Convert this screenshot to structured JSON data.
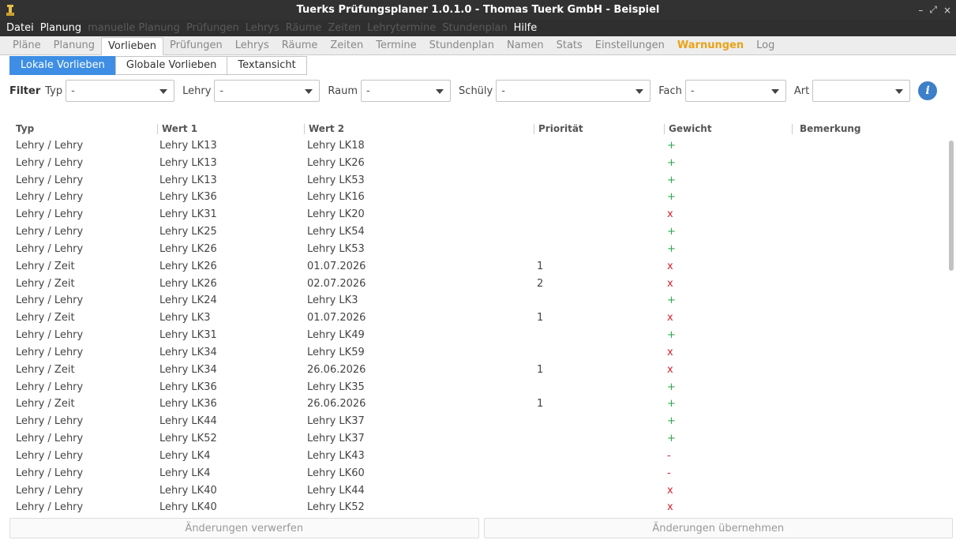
{
  "window": {
    "title": "Tuerks Prüfungsplaner 1.0.1.0 - Thomas Tuerk GmbH - Beispiel",
    "controls": [
      "–",
      "⤢",
      "×"
    ]
  },
  "menu": [
    {
      "label": "Datei",
      "disabled": false
    },
    {
      "label": "Planung",
      "disabled": false
    },
    {
      "label": "manuelle Planung",
      "disabled": true
    },
    {
      "label": "Prüfungen",
      "disabled": true
    },
    {
      "label": "Lehrys",
      "disabled": true
    },
    {
      "label": "Räume",
      "disabled": true
    },
    {
      "label": "Zeiten",
      "disabled": true
    },
    {
      "label": "Lehrytermine",
      "disabled": true
    },
    {
      "label": "Stundenplan",
      "disabled": true
    },
    {
      "label": "Hilfe",
      "disabled": false
    }
  ],
  "tabs": [
    {
      "label": "Pläne"
    },
    {
      "label": "Planung"
    },
    {
      "label": "Vorlieben",
      "active": true
    },
    {
      "label": "Prüfungen"
    },
    {
      "label": "Lehrys"
    },
    {
      "label": "Räume"
    },
    {
      "label": "Zeiten"
    },
    {
      "label": "Termine"
    },
    {
      "label": "Stundenplan"
    },
    {
      "label": "Namen"
    },
    {
      "label": "Stats"
    },
    {
      "label": "Einstellungen"
    },
    {
      "label": "Warnungen",
      "warn": true
    },
    {
      "label": "Log"
    }
  ],
  "subtabs": [
    {
      "label": "Lokale Vorlieben",
      "active": true
    },
    {
      "label": "Globale Vorlieben"
    },
    {
      "label": "Textansicht"
    }
  ],
  "filter": {
    "label": "Filter",
    "fields": [
      {
        "label": "Typ",
        "value": "-"
      },
      {
        "label": "Lehry",
        "value": "-"
      },
      {
        "label": "Raum",
        "value": "-"
      },
      {
        "label": "Schüly",
        "value": "-"
      },
      {
        "label": "Fach",
        "value": "-"
      },
      {
        "label": "Art",
        "value": ""
      }
    ],
    "info_glyph": "i"
  },
  "table": {
    "columns": [
      "Typ",
      "Wert 1",
      "Wert 2",
      "Priorität",
      "Gewicht",
      "Bemerkung"
    ],
    "rows": [
      {
        "typ": "Lehry / Lehry",
        "w1": "Lehry LK13",
        "w2": "Lehry LK18",
        "prio": "",
        "gewicht": "+",
        "bem": ""
      },
      {
        "typ": "Lehry / Lehry",
        "w1": "Lehry LK13",
        "w2": "Lehry LK26",
        "prio": "",
        "gewicht": "+",
        "bem": ""
      },
      {
        "typ": "Lehry / Lehry",
        "w1": "Lehry LK13",
        "w2": "Lehry LK53",
        "prio": "",
        "gewicht": "+",
        "bem": ""
      },
      {
        "typ": "Lehry / Lehry",
        "w1": "Lehry LK36",
        "w2": "Lehry LK16",
        "prio": "",
        "gewicht": "+",
        "bem": ""
      },
      {
        "typ": "Lehry / Lehry",
        "w1": "Lehry LK31",
        "w2": "Lehry LK20",
        "prio": "",
        "gewicht": "x",
        "bem": ""
      },
      {
        "typ": "Lehry / Lehry",
        "w1": "Lehry LK25",
        "w2": "Lehry LK54",
        "prio": "",
        "gewicht": "+",
        "bem": ""
      },
      {
        "typ": "Lehry / Lehry",
        "w1": "Lehry LK26",
        "w2": "Lehry LK53",
        "prio": "",
        "gewicht": "+",
        "bem": ""
      },
      {
        "typ": "Lehry / Zeit",
        "w1": "Lehry LK26",
        "w2": "01.07.2026",
        "prio": "1",
        "gewicht": "x",
        "bem": ""
      },
      {
        "typ": "Lehry / Zeit",
        "w1": "Lehry LK26",
        "w2": "02.07.2026",
        "prio": "2",
        "gewicht": "x",
        "bem": ""
      },
      {
        "typ": "Lehry / Lehry",
        "w1": "Lehry LK24",
        "w2": "Lehry LK3",
        "prio": "",
        "gewicht": "+",
        "bem": ""
      },
      {
        "typ": "Lehry / Zeit",
        "w1": "Lehry LK3",
        "w2": "01.07.2026",
        "prio": "1",
        "gewicht": "x",
        "bem": ""
      },
      {
        "typ": "Lehry / Lehry",
        "w1": "Lehry LK31",
        "w2": "Lehry LK49",
        "prio": "",
        "gewicht": "+",
        "bem": ""
      },
      {
        "typ": "Lehry / Lehry",
        "w1": "Lehry LK34",
        "w2": "Lehry LK59",
        "prio": "",
        "gewicht": "x",
        "bem": ""
      },
      {
        "typ": "Lehry / Zeit",
        "w1": "Lehry LK34",
        "w2": "26.06.2026",
        "prio": "1",
        "gewicht": "x",
        "bem": ""
      },
      {
        "typ": "Lehry / Lehry",
        "w1": "Lehry LK36",
        "w2": "Lehry LK35",
        "prio": "",
        "gewicht": "+",
        "bem": ""
      },
      {
        "typ": "Lehry / Zeit",
        "w1": "Lehry LK36",
        "w2": "26.06.2026",
        "prio": "1",
        "gewicht": "+",
        "bem": ""
      },
      {
        "typ": "Lehry / Lehry",
        "w1": "Lehry LK44",
        "w2": "Lehry LK37",
        "prio": "",
        "gewicht": "+",
        "bem": ""
      },
      {
        "typ": "Lehry / Lehry",
        "w1": "Lehry LK52",
        "w2": "Lehry LK37",
        "prio": "",
        "gewicht": "+",
        "bem": ""
      },
      {
        "typ": "Lehry / Lehry",
        "w1": "Lehry LK4",
        "w2": "Lehry LK43",
        "prio": "",
        "gewicht": "-",
        "bem": ""
      },
      {
        "typ": "Lehry / Lehry",
        "w1": "Lehry LK4",
        "w2": "Lehry LK60",
        "prio": "",
        "gewicht": "-",
        "bem": ""
      },
      {
        "typ": "Lehry / Lehry",
        "w1": "Lehry LK40",
        "w2": "Lehry LK44",
        "prio": "",
        "gewicht": "x",
        "bem": ""
      },
      {
        "typ": "Lehry / Lehry",
        "w1": "Lehry LK40",
        "w2": "Lehry LK52",
        "prio": "",
        "gewicht": "x",
        "bem": ""
      }
    ]
  },
  "footer": {
    "discard_label": "Änderungen verwerfen",
    "apply_label": "Änderungen übernehmen"
  },
  "colors": {
    "accent": "#3d8ee4",
    "warning": "#e8a317",
    "plus": "#2fa84f",
    "cross": "#d9232e"
  }
}
